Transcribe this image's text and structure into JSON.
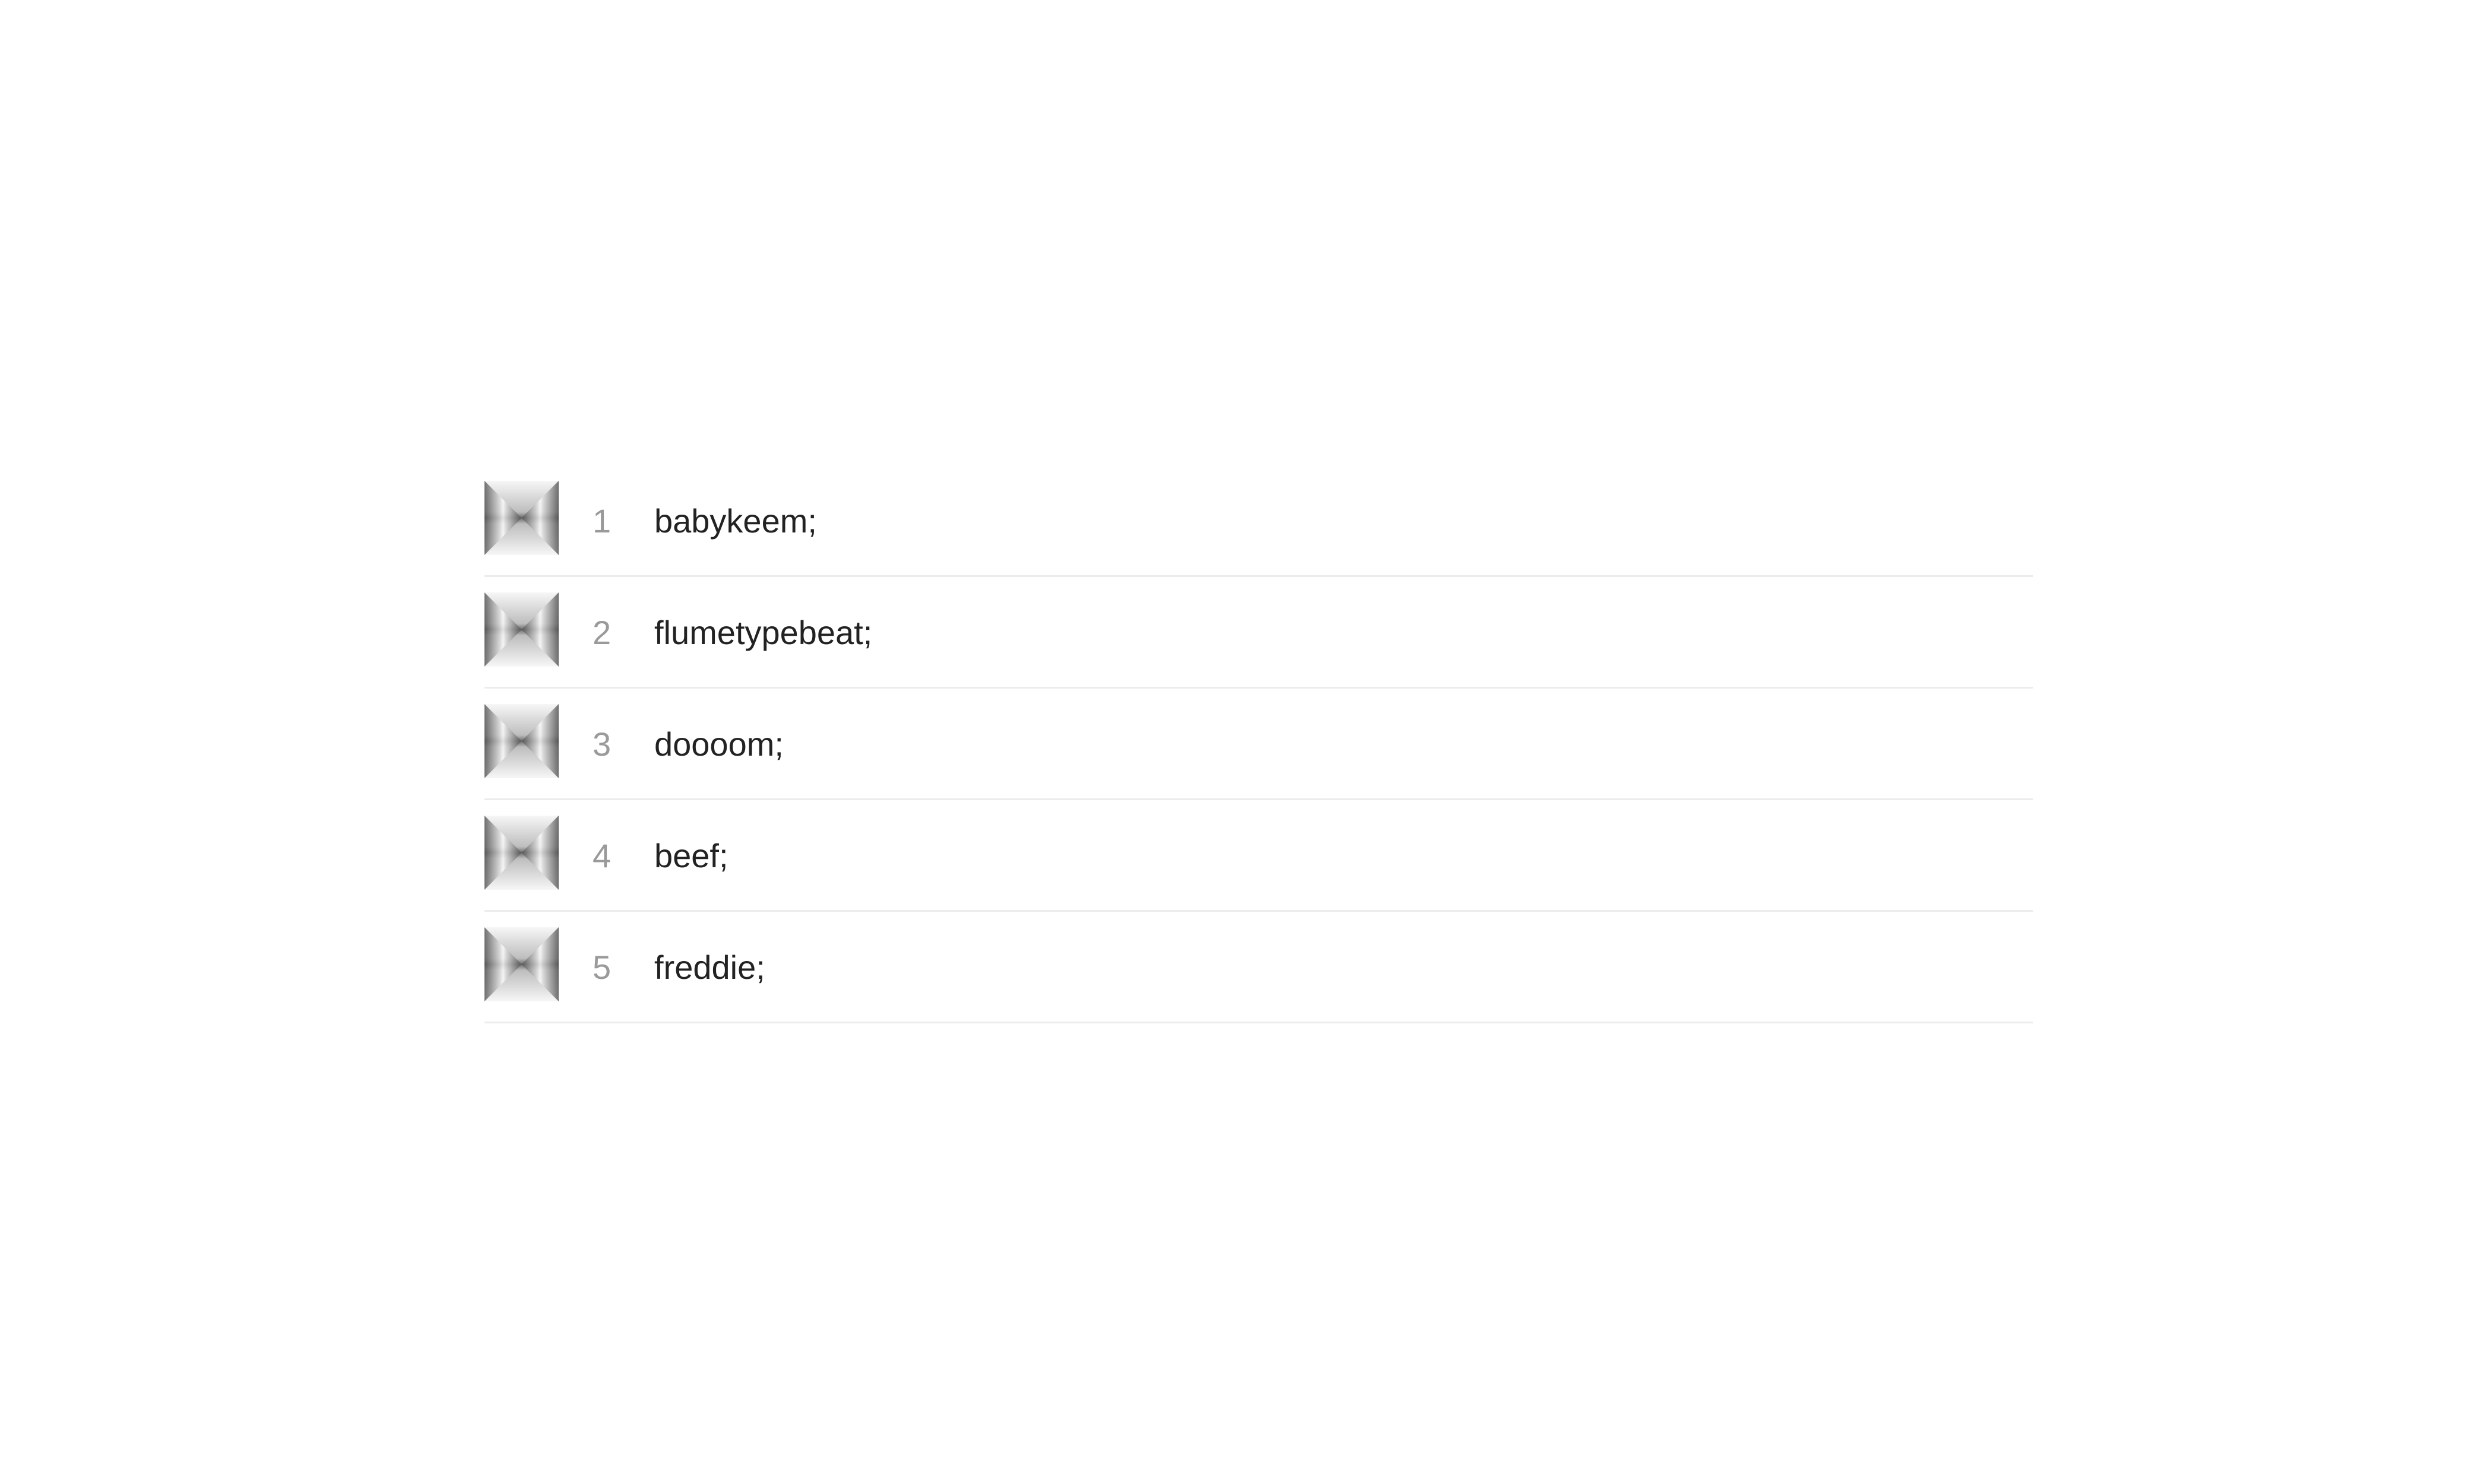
{
  "tracks": [
    {
      "number": "1",
      "title": "babykeem;",
      "artwork_icon": "album-artwork-placeholder-icon"
    },
    {
      "number": "2",
      "title": "flumetypebeat;",
      "artwork_icon": "album-artwork-placeholder-icon"
    },
    {
      "number": "3",
      "title": "doooom;",
      "artwork_icon": "album-artwork-placeholder-icon"
    },
    {
      "number": "4",
      "title": "beef;",
      "artwork_icon": "album-artwork-placeholder-icon"
    },
    {
      "number": "5",
      "title": "freddie;",
      "artwork_icon": "album-artwork-placeholder-icon"
    }
  ],
  "colors": {
    "background": "#ffffff",
    "title_text": "#222222",
    "number_text": "#9a9a9a",
    "divider": "#ececec"
  }
}
